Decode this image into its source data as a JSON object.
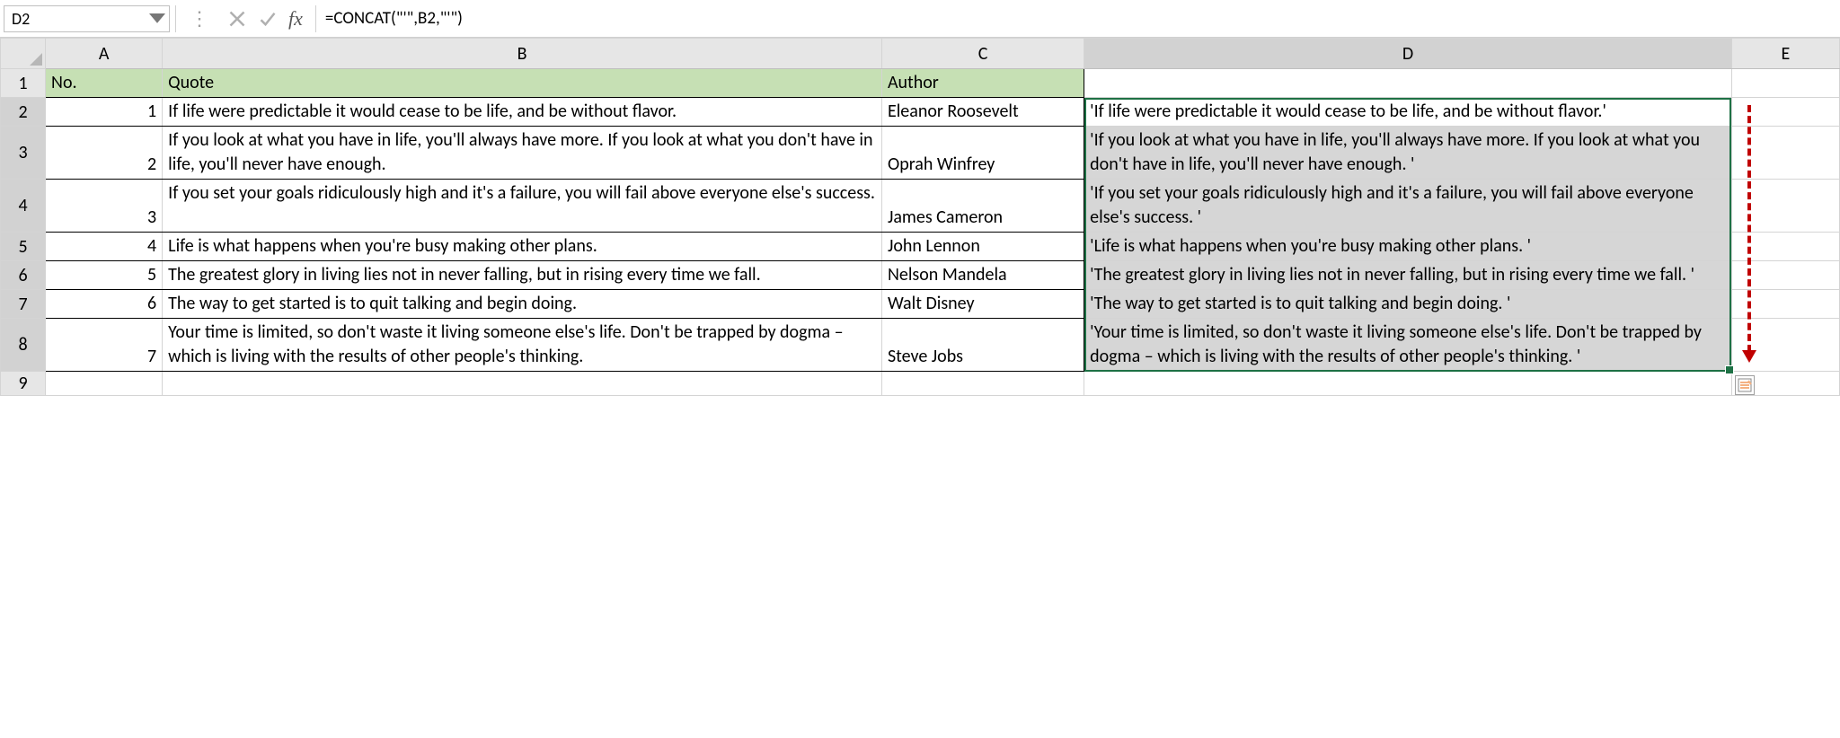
{
  "formula_bar": {
    "name_box": "D2",
    "formula": "=CONCAT(\"'\",B2,\"'\")"
  },
  "columns": {
    "A": "A",
    "B": "B",
    "C": "C",
    "D": "D",
    "E": "E"
  },
  "header_row": {
    "A": "No.",
    "B": "Quote",
    "C": "Author",
    "D": ""
  },
  "rows": [
    {
      "row_label": "2",
      "no": "1",
      "quote": "If life were predictable it would cease to be life, and be without flavor.",
      "author": "Eleanor Roosevelt",
      "d": "'If life were predictable it would cease to be life, and be without flavor.'"
    },
    {
      "row_label": "3",
      "no": "2",
      "quote": "If you look at what you have in life, you'll always have more. If you look at what you don't have in life, you'll never have enough.",
      "author": "Oprah Winfrey",
      "d": "'If you look at what you have in life, you'll always have more. If you look at what you don't have in life, you'll never have enough. '"
    },
    {
      "row_label": "4",
      "no": "3",
      "quote": "If you set your goals ridiculously high and it's a failure, you will fail above everyone else's success.",
      "author": "James Cameron",
      "d": "'If you set your goals ridiculously high and it's a failure, you will fail above everyone else's success. '"
    },
    {
      "row_label": "5",
      "no": "4",
      "quote": "Life is what happens when you're busy making other plans.",
      "author": "John Lennon",
      "d": "'Life is what happens when you're busy making other plans. '"
    },
    {
      "row_label": "6",
      "no": "5",
      "quote": "The greatest glory in living lies not in never falling, but in rising every time we fall.",
      "author": "Nelson Mandela",
      "d": "'The greatest glory in living lies not in never falling, but in rising every time we fall. '"
    },
    {
      "row_label": "7",
      "no": "6",
      "quote": "The way to get started is to quit talking and begin doing.",
      "author": "Walt Disney",
      "d": "'The way to get started is to quit talking and begin doing. '"
    },
    {
      "row_label": "8",
      "no": "7",
      "quote": "Your time is limited, so don't waste it living someone else's life. Don't be trapped by dogma – which is living with the results of other people's thinking.",
      "author": "Steve Jobs",
      "d": "'Your time is limited, so don't waste it living someone else's life. Don't be trapped by dogma – which is living with the results of other people's thinking. '"
    }
  ],
  "extra_row_label": "9",
  "selection": {
    "active_cell": "D2",
    "range": "D2:D8"
  }
}
